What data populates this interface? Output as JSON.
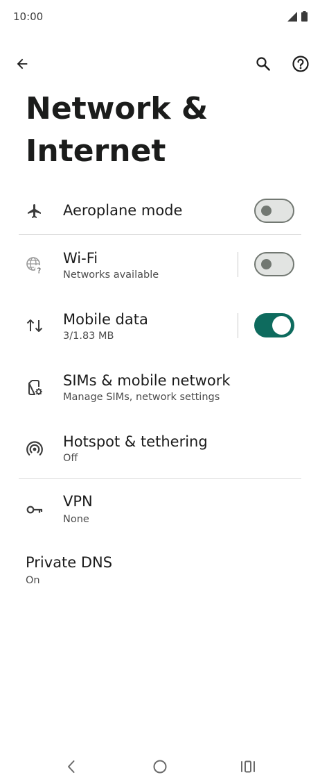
{
  "status_bar": {
    "time": "10:00",
    "icons": [
      "signal-icon",
      "battery-icon"
    ]
  },
  "toolbar": {
    "back_icon": "back-arrow-icon",
    "search_icon": "search-icon",
    "help_icon": "help-icon"
  },
  "page": {
    "title_line1": "Network &",
    "title_line2": "Internet"
  },
  "settings": {
    "aeroplane": {
      "title": "Aeroplane mode",
      "toggle_on": false,
      "icon": "airplane-icon"
    },
    "wifi": {
      "title": "Wi-Fi",
      "subtitle": "Networks available",
      "toggle_on": false,
      "icon": "wifi-globe-icon"
    },
    "mobile_data": {
      "title": "Mobile data",
      "subtitle": "3/1.83 MB",
      "toggle_on": true,
      "icon": "data-arrows-icon"
    },
    "sims": {
      "title": "SIMs & mobile network",
      "subtitle": "Manage SIMs, network settings",
      "icon": "sim-settings-icon"
    },
    "hotspot": {
      "title": "Hotspot & tethering",
      "subtitle": "Off",
      "icon": "hotspot-icon"
    },
    "vpn": {
      "title": "VPN",
      "subtitle": "None",
      "icon": "key-icon"
    },
    "private_dns": {
      "title": "Private DNS",
      "subtitle": "On"
    }
  },
  "nav_bar": {
    "back": "nav-back-icon",
    "home": "nav-home-icon",
    "recents": "nav-recents-icon"
  },
  "colors": {
    "accent": "#0e6b5e",
    "switch_off_track": "#e2e4e2",
    "switch_off_border": "#727872"
  }
}
